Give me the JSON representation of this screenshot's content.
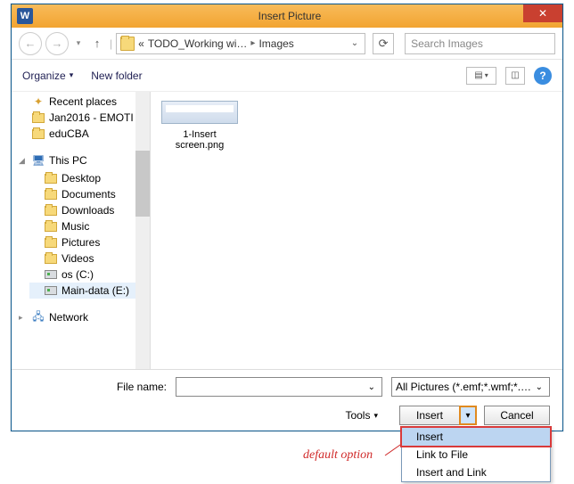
{
  "title": "Insert Picture",
  "app_icon_letter": "W",
  "nav": {
    "breadcrumb_prefix": "«",
    "breadcrumb_parts": [
      "TODO_Working wi…",
      "Images"
    ],
    "search_placeholder": "Search Images"
  },
  "toolbar": {
    "organize": "Organize",
    "newfolder": "New folder"
  },
  "tree": {
    "items": [
      {
        "label": "Recent places",
        "icon": "recent"
      },
      {
        "label": "Jan2016 - EMOTI",
        "icon": "folder"
      },
      {
        "label": "eduCBA",
        "icon": "folder"
      }
    ],
    "pc_label": "This PC",
    "pc_children": [
      {
        "label": "Desktop",
        "icon": "folder"
      },
      {
        "label": "Documents",
        "icon": "folder"
      },
      {
        "label": "Downloads",
        "icon": "folder"
      },
      {
        "label": "Music",
        "icon": "folder"
      },
      {
        "label": "Pictures",
        "icon": "folder"
      },
      {
        "label": "Videos",
        "icon": "folder"
      },
      {
        "label": "os (C:)",
        "icon": "drive"
      },
      {
        "label": "Main-data (E:)",
        "icon": "drive",
        "selected": true
      }
    ],
    "network_label": "Network"
  },
  "content": {
    "files": [
      {
        "name_line1": "1-Insert",
        "name_line2": "screen.png"
      }
    ]
  },
  "footer": {
    "filename_label": "File name:",
    "filename_value": "",
    "filter_value": "All Pictures (*.emf;*.wmf;*.jpg;*",
    "tools_label": "Tools",
    "insert_label": "Insert",
    "cancel_label": "Cancel"
  },
  "dropdown": {
    "items": [
      "Insert",
      "Link to File",
      "Insert and Link"
    ],
    "selected_index": 0
  },
  "annotation": "default option"
}
